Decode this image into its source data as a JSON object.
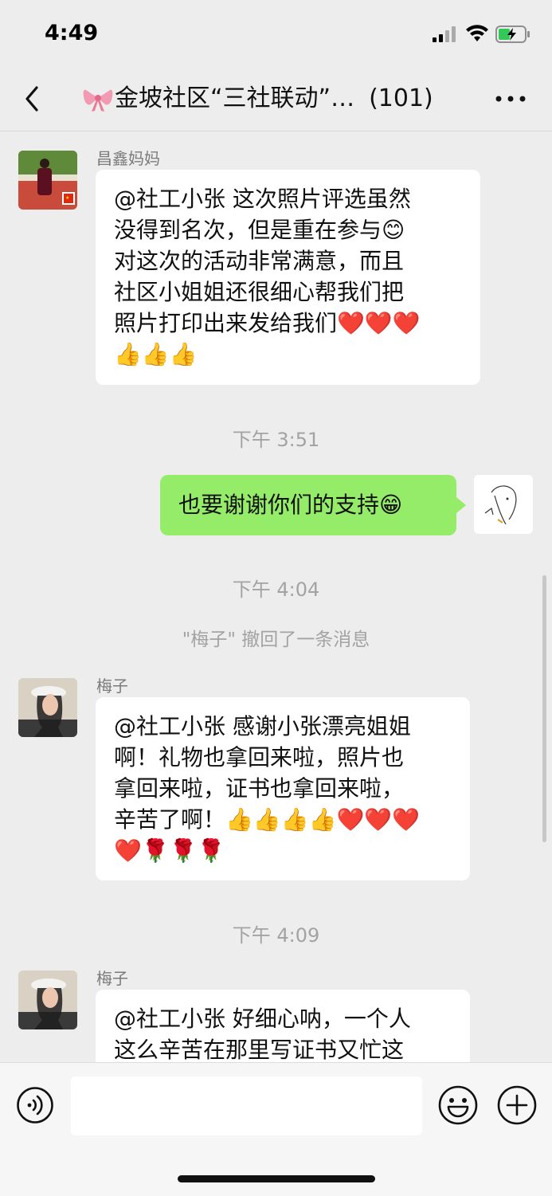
{
  "status_bar": {
    "time": "4:49",
    "battery_charging": true
  },
  "header": {
    "title_icon": "ribbon-bow",
    "title": "金坡社区“三社联动”…",
    "member_count": "(101)"
  },
  "messages": [
    {
      "sender": "昌鑫妈妈",
      "text": "@社工小张 这次照片评选虽然\n没得到名次，但是重在参与😊\n对这次的活动非常满意，而且\n社区小姐姐还很细心帮我们把\n照片打印出来发给我们❤️❤️❤️\n👍👍👍"
    },
    {
      "timestamp": "下午 3:51"
    },
    {
      "self_text": "也要谢谢你们的支持😁"
    },
    {
      "timestamp": "下午 4:04"
    },
    {
      "system_text": "\"梅子\" 撤回了一条消息"
    },
    {
      "sender": "梅子",
      "text": "@社工小张 感谢小张漂亮姐姐\n啊！礼物也拿回来啦，照片也\n拿回来啦，证书也拿回来啦，\n辛苦了啊！👍👍👍👍❤️❤️❤️\n❤️🌹🌹🌹"
    },
    {
      "timestamp": "下午 4:09"
    },
    {
      "sender": "梅子",
      "text": "@社工小张 好细心呐，一个人\n这么辛苦在那里写证书又忙这"
    }
  ],
  "input": {
    "value": "",
    "placeholder": ""
  },
  "colors": {
    "background": "#ededed",
    "self_bubble": "#95ec69",
    "other_bubble": "#ffffff",
    "timestamp": "#a3a3a3"
  }
}
